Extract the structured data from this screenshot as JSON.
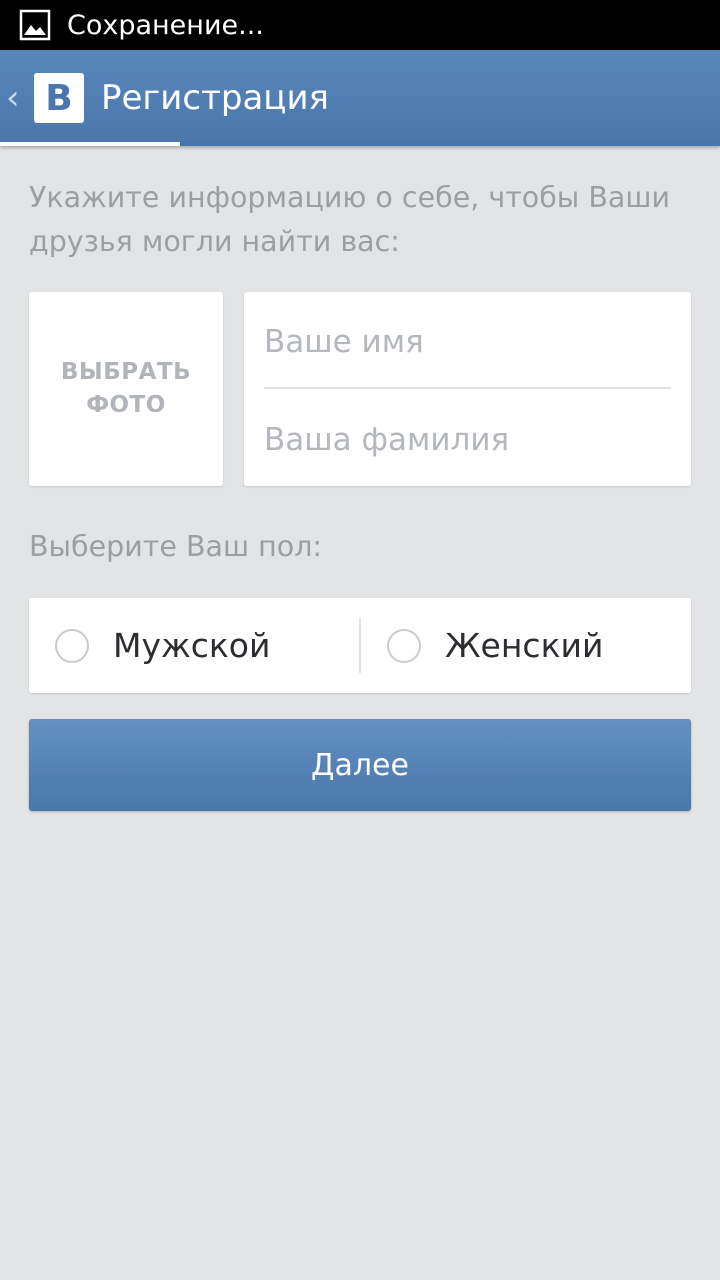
{
  "status_bar": {
    "icon": "image-icon",
    "text": "Сохранение..."
  },
  "action_bar": {
    "back_icon": "chevron-left-icon",
    "logo_letter": "B",
    "title": "Регистрация"
  },
  "form": {
    "intro": "Укажите информацию о себе, чтобы Ваши друзья могли найти вас:",
    "photo_button": "ВЫБРАТЬ\nФОТО",
    "first_name": {
      "value": "",
      "placeholder": "Ваше имя"
    },
    "last_name": {
      "value": "",
      "placeholder": "Ваша фамилия"
    },
    "gender_label": "Выберите Ваш пол:",
    "gender_options": [
      {
        "label": "Мужской",
        "selected": false
      },
      {
        "label": "Женский",
        "selected": false
      }
    ],
    "next_button": "Далее"
  },
  "colors": {
    "accent": "#4a76ab",
    "background": "#e3e4e6"
  }
}
